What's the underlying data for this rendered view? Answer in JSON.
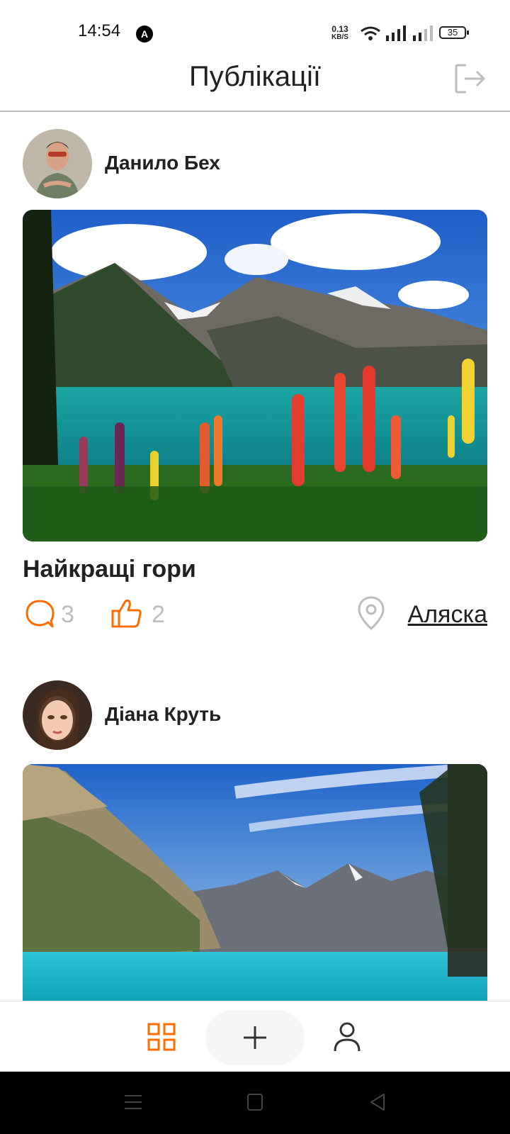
{
  "status_bar": {
    "time": "14:54",
    "net_speed_value": "0.13",
    "net_speed_unit": "KB/S",
    "battery": "35"
  },
  "header": {
    "title": "Публікації",
    "logout_icon": "logout-icon"
  },
  "posts": [
    {
      "author": "Данило Бех",
      "title": "Найкращі гори",
      "comments": "3",
      "likes": "2",
      "location": "Аляска"
    },
    {
      "author": "Діана Круть"
    }
  ],
  "bottom_nav": {
    "items": [
      "grid-icon",
      "plus-icon",
      "user-icon"
    ],
    "active_color": "#FF6C00"
  },
  "colors": {
    "accent": "#FF6C00",
    "muted": "#BDBDBD",
    "text": "#212121"
  }
}
